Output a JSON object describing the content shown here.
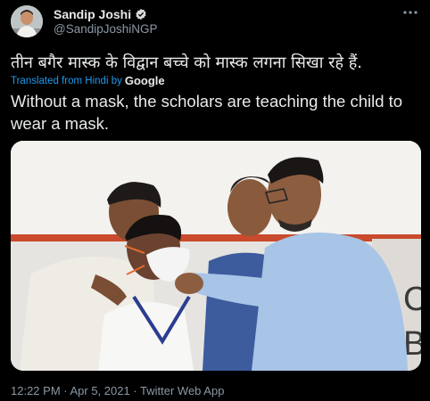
{
  "tweet": {
    "author": {
      "display_name": "Sandip Joshi",
      "handle": "@SandipJoshiNGP",
      "avatar_icon": "profile-photo",
      "verified_icon": "verified-badge-icon",
      "verified_color": "#d9d9d9"
    },
    "more_icon": "more-options-icon",
    "original_text": "तीन बगैर मास्क के विद्वान बच्चे को मास्क लगना सिखा रहे हैं.",
    "translated_from": "Translated from Hindi by",
    "translator": "Google",
    "translation": "Without a mask, the scholars are teaching the child to wear a mask.",
    "photo": {
      "backdrop_letters": [
        "C",
        "B"
      ]
    },
    "timestamp": "12:22 PM · Apr 5, 2021 · Twitter Web App"
  },
  "colors": {
    "background": "#000000",
    "primary_text": "#e7e9ea",
    "secondary_text": "#8b98a5",
    "link": "#1d9bf0"
  }
}
